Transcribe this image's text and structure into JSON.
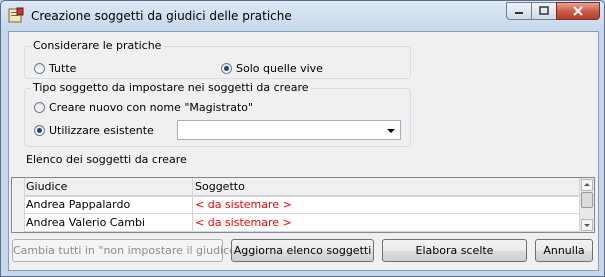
{
  "window": {
    "title": "Creazione soggetti da giudici delle pratiche"
  },
  "group_pratiche": {
    "label": "Considerare le pratiche",
    "options": [
      {
        "label": "Tutte",
        "checked": false
      },
      {
        "label": "Solo quelle vive",
        "checked": true
      }
    ]
  },
  "group_tipo": {
    "label": "Tipo soggetto da impostare nei soggetti da creare",
    "options": [
      {
        "label": "Creare nuovo con nome \"Magistrato\"",
        "checked": false
      },
      {
        "label": "Utilizzare esistente",
        "checked": true
      }
    ],
    "combo_value": ""
  },
  "list_label": "Elenco dei soggetti da creare",
  "table": {
    "columns": [
      "Giudice",
      "Soggetto"
    ],
    "rows": [
      [
        "Andrea Pappalardo",
        "< da sistemare >"
      ],
      [
        "Andrea Valerio Cambi",
        "< da sistemare >"
      ]
    ]
  },
  "buttons": {
    "change_all": "Cambia tutti in \"non impostare il giudice\"",
    "refresh": "Aggiorna elenco soggetti",
    "process": "Elabora scelte",
    "cancel": "Annulla"
  },
  "colors": {
    "placeholder_text": "#ff0000",
    "radio_dot": "#1f3f86"
  }
}
